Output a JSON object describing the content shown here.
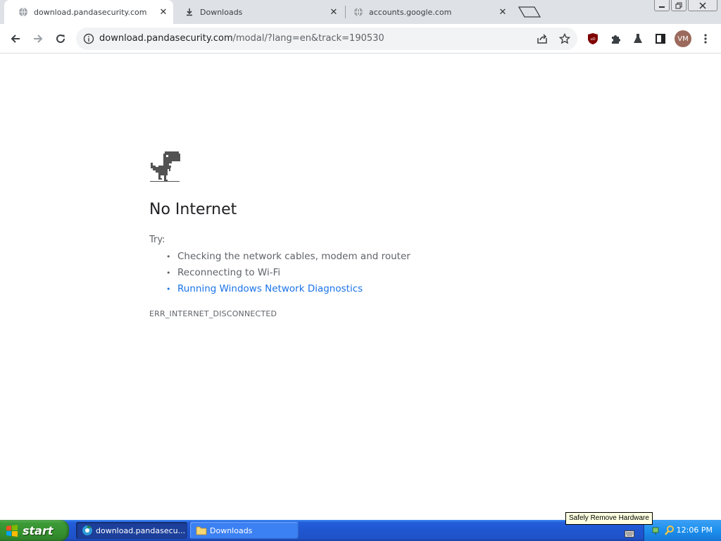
{
  "browser": {
    "tabs": [
      {
        "title": "download.pandasecurity.com",
        "active": true,
        "icon": "globe-icon"
      },
      {
        "title": "Downloads",
        "active": false,
        "icon": "download-icon"
      },
      {
        "title": "accounts.google.com",
        "active": false,
        "icon": "globe-icon"
      }
    ],
    "address": {
      "host": "download.pandasecurity.com",
      "path": "/modal/?lang=en&track=190530"
    },
    "profile_initials": "VM"
  },
  "error_page": {
    "heading": "No Internet",
    "try_label": "Try:",
    "suggestions": [
      "Checking the network cables, modem and router",
      "Reconnecting to Wi-Fi",
      "Running Windows Network Diagnostics"
    ],
    "error_code": "ERR_INTERNET_DISCONNECTED"
  },
  "taskbar": {
    "start_label": "start",
    "tasks": [
      {
        "label": "download.pandasecu...",
        "active": true
      },
      {
        "label": "Downloads",
        "active": false
      }
    ],
    "clock": "12:06 PM",
    "tooltip": "Safely Remove Hardware"
  },
  "colors": {
    "link": "#1a73e8",
    "tabstrip": "#dee1e6",
    "taskbar": "#245edb",
    "start": "#3c9a37"
  }
}
